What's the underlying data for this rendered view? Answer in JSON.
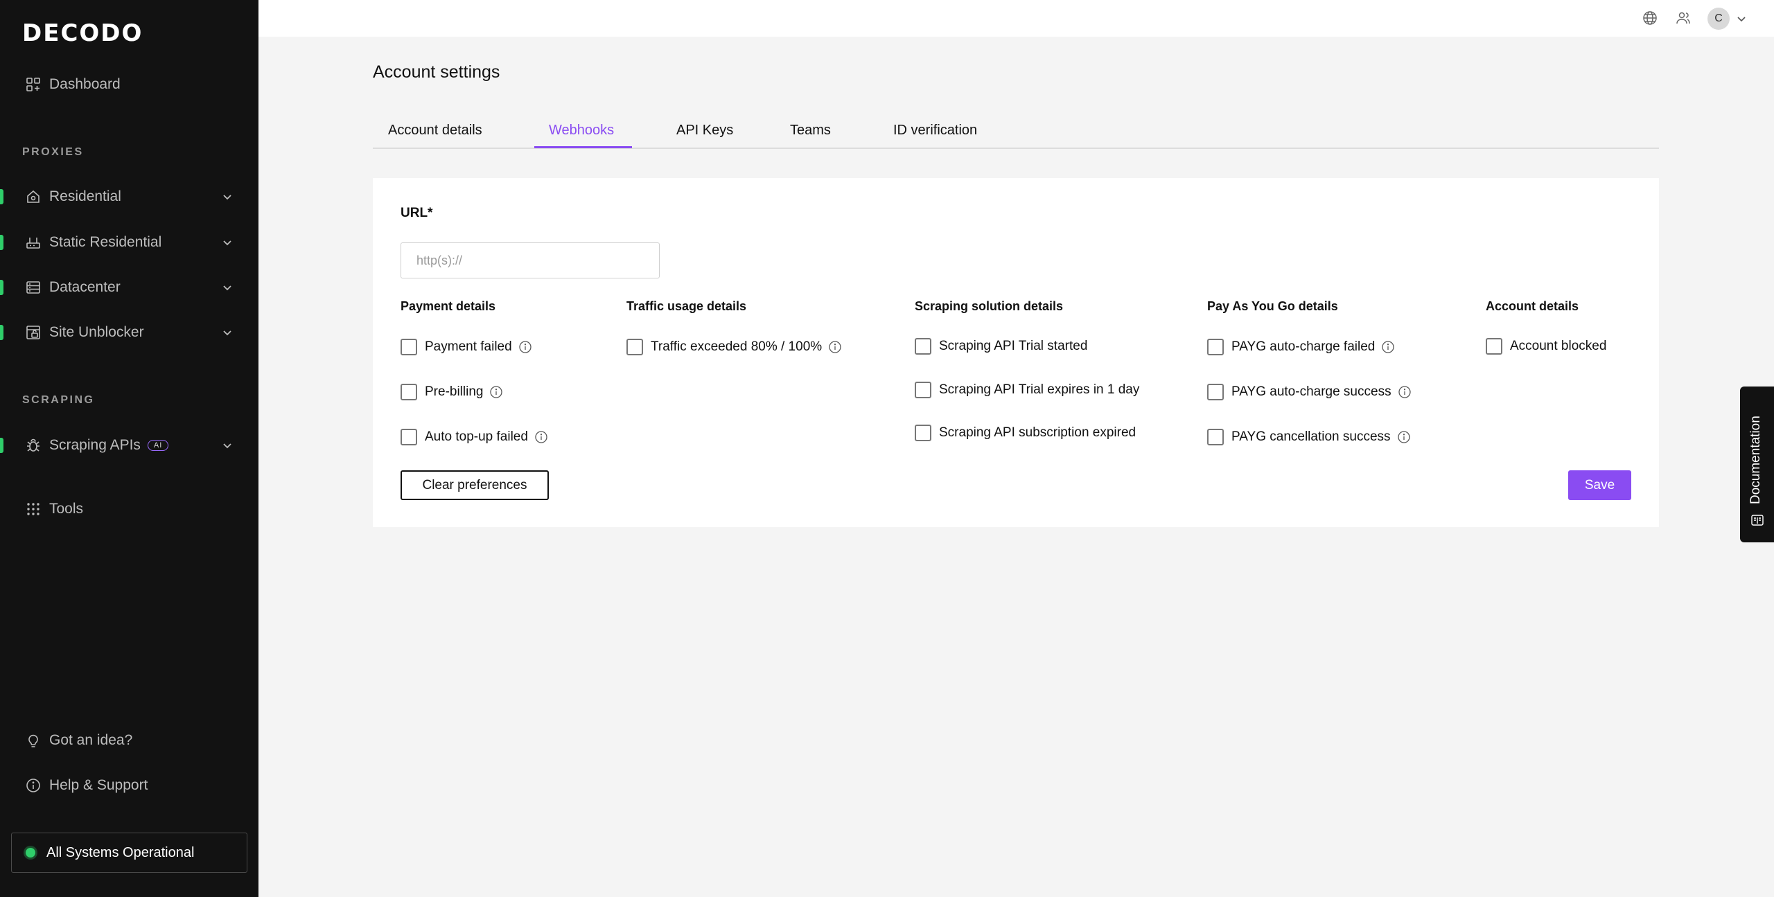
{
  "sidebar": {
    "logo": "DECODO",
    "dashboard": "Dashboard",
    "proxies_section": "PROXIES",
    "residential": "Residential",
    "static_residential": "Static Residential",
    "datacenter": "Datacenter",
    "site_unblocker": "Site Unblocker",
    "scraping_section": "SCRAPING",
    "scraping_apis": "Scraping APIs",
    "ai_badge": "AI",
    "tools": "Tools",
    "got_an_idea": "Got an idea?",
    "help_support": "Help & Support",
    "status": "All Systems Operational"
  },
  "topbar": {
    "avatar_initial": "C"
  },
  "page": {
    "title": "Account settings"
  },
  "tabs": {
    "account_details": "Account details",
    "webhooks": "Webhooks",
    "api_keys": "API Keys",
    "teams": "Teams",
    "id_verification": "ID verification"
  },
  "form": {
    "url_label": "URL*",
    "url_placeholder": "http(s)://",
    "url_value": ""
  },
  "columns": {
    "payment": {
      "title": "Payment details",
      "opt1": "Payment failed",
      "opt2": "Pre-billing",
      "opt3": "Auto top-up failed"
    },
    "traffic": {
      "title": "Traffic usage details",
      "opt1": "Traffic exceeded 80% / 100%"
    },
    "scraping": {
      "title": "Scraping solution details",
      "opt1": "Scraping API Trial started",
      "opt2": "Scraping API Trial expires in 1 day",
      "opt3": "Scraping API subscription expired"
    },
    "payg": {
      "title": "Pay As You Go details",
      "opt1": "PAYG auto-charge failed",
      "opt2": "PAYG auto-charge success",
      "opt3": "PAYG cancellation success"
    },
    "account": {
      "title": "Account details",
      "opt1": "Account blocked"
    }
  },
  "actions": {
    "clear": "Clear preferences",
    "save": "Save"
  },
  "documentation": "Documentation",
  "colors": {
    "accent": "#8a4cf2",
    "sidebar_bg": "#121212",
    "status_green": "#2fce6a"
  },
  "icons": {
    "dashboard": "dashboard-icon",
    "residential": "home-icon",
    "static_residential": "router-icon",
    "datacenter": "server-icon",
    "site_unblocker": "unlock-icon",
    "scraping_apis": "bug-icon",
    "tools": "grid-icon",
    "idea": "lightbulb-icon",
    "help": "info-icon",
    "globe": "globe-icon",
    "users": "users-icon"
  }
}
